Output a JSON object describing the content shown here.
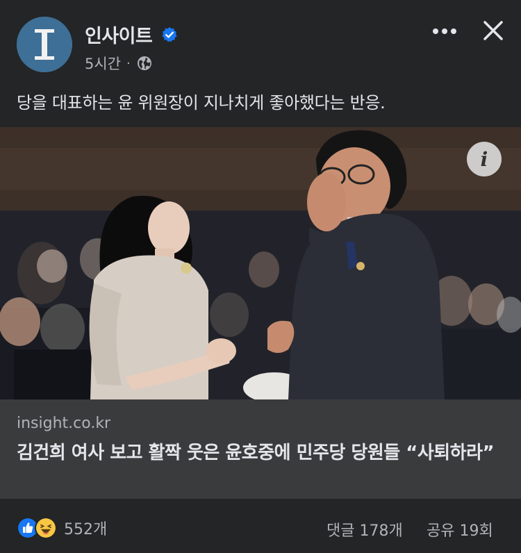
{
  "post": {
    "page_name": "인사이트",
    "avatar_letter": "I",
    "time_ago": "5시간",
    "separator": "·",
    "caption": "당을 대표하는 윤 위원장이 지나치게 좋아했다는 반응.",
    "icons": [
      "verified-badge-icon",
      "globe-icon",
      "more-icon",
      "close-icon",
      "info-icon",
      "like-reaction-icon",
      "haha-reaction-icon"
    ],
    "accent_color": "#1877f2"
  },
  "link_preview": {
    "domain": "insight.co.kr",
    "headline": "김건희 여사 보고 활짝 웃은 윤호중에 민주당 당원들 “사퇴하라”"
  },
  "footer": {
    "reaction_count": "552개",
    "comments": "댓글 178개",
    "shares": "공유 19회"
  }
}
